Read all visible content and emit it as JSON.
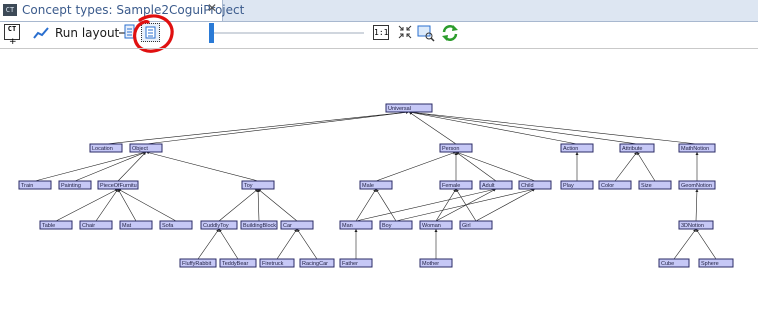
{
  "tab": {
    "icon_label": "CT",
    "title": "Concept types: Sample2CoguiProject",
    "close_glyph": "✕"
  },
  "toolbar": {
    "ct_label": "CT",
    "ct_plus": "+",
    "run_layout_label": "Run layout",
    "one_to_one_label": "1:1",
    "icons": [
      "new-concept-type-icon",
      "run-layout-icon",
      "zoom-out-icon",
      "fit-to-window-icon",
      "zoom-slider",
      "actual-size-icon",
      "shrink-icon",
      "zoom-rectangle-icon",
      "refresh-icon"
    ]
  },
  "colors": {
    "node_fill": "#c6c8f6",
    "node_border": "#2b2b66",
    "annotation": "#e01010",
    "tab_text": "#3b5b8c"
  },
  "graph": {
    "nodes": [
      {
        "id": "Universal",
        "label": "Universal"
      },
      {
        "id": "Location",
        "label": "Location"
      },
      {
        "id": "Object",
        "label": "Object"
      },
      {
        "id": "Person",
        "label": "Person"
      },
      {
        "id": "Action",
        "label": "Action"
      },
      {
        "id": "Attribute",
        "label": "Attribute"
      },
      {
        "id": "MathNotion",
        "label": "MathNotion"
      },
      {
        "id": "Train",
        "label": "Train"
      },
      {
        "id": "Painting",
        "label": "Painting"
      },
      {
        "id": "PieceOfFurniture",
        "label": "PieceOfFurnitu"
      },
      {
        "id": "Toy",
        "label": "Toy"
      },
      {
        "id": "Male",
        "label": "Male"
      },
      {
        "id": "Female",
        "label": "Female"
      },
      {
        "id": "Adult",
        "label": "Adult"
      },
      {
        "id": "Child",
        "label": "Child"
      },
      {
        "id": "Play",
        "label": "Play"
      },
      {
        "id": "Color",
        "label": "Color"
      },
      {
        "id": "Size",
        "label": "Size"
      },
      {
        "id": "GeomNotion",
        "label": "GeomNotion"
      },
      {
        "id": "Table",
        "label": "Table"
      },
      {
        "id": "Chair",
        "label": "Chair"
      },
      {
        "id": "Mat",
        "label": "Mat"
      },
      {
        "id": "Sofa",
        "label": "Sofa"
      },
      {
        "id": "CuddlyToy",
        "label": "CuddlyToy"
      },
      {
        "id": "BuildingBlock",
        "label": "BuildingBlock"
      },
      {
        "id": "Car",
        "label": "Car"
      },
      {
        "id": "Man",
        "label": "Man"
      },
      {
        "id": "Boy",
        "label": "Boy"
      },
      {
        "id": "Woman",
        "label": "Woman"
      },
      {
        "id": "Girl",
        "label": "Girl"
      },
      {
        "id": "ThreeDNotion",
        "label": "3DNotion"
      },
      {
        "id": "FluffyRabbit",
        "label": "FluffyRabbit"
      },
      {
        "id": "TeddyBear",
        "label": "TeddyBear"
      },
      {
        "id": "Firetruck",
        "label": "Firetruck"
      },
      {
        "id": "RacingCar",
        "label": "RacingCar"
      },
      {
        "id": "Father",
        "label": "Father"
      },
      {
        "id": "Mother",
        "label": "Mother"
      },
      {
        "id": "Cube",
        "label": "Cube"
      },
      {
        "id": "Sphere",
        "label": "Sphere"
      }
    ],
    "edges": [
      [
        "Location",
        "Universal"
      ],
      [
        "Object",
        "Universal"
      ],
      [
        "Person",
        "Universal"
      ],
      [
        "Action",
        "Universal"
      ],
      [
        "Attribute",
        "Universal"
      ],
      [
        "MathNotion",
        "Universal"
      ],
      [
        "Train",
        "Object"
      ],
      [
        "Painting",
        "Object"
      ],
      [
        "PieceOfFurniture",
        "Object"
      ],
      [
        "Toy",
        "Object"
      ],
      [
        "Male",
        "Person"
      ],
      [
        "Female",
        "Person"
      ],
      [
        "Adult",
        "Person"
      ],
      [
        "Child",
        "Person"
      ],
      [
        "Play",
        "Action"
      ],
      [
        "Color",
        "Attribute"
      ],
      [
        "Size",
        "Attribute"
      ],
      [
        "GeomNotion",
        "MathNotion"
      ],
      [
        "Table",
        "PieceOfFurniture"
      ],
      [
        "Chair",
        "PieceOfFurniture"
      ],
      [
        "Mat",
        "PieceOfFurniture"
      ],
      [
        "Sofa",
        "PieceOfFurniture"
      ],
      [
        "CuddlyToy",
        "Toy"
      ],
      [
        "BuildingBlock",
        "Toy"
      ],
      [
        "Car",
        "Toy"
      ],
      [
        "Man",
        "Male"
      ],
      [
        "Man",
        "Adult"
      ],
      [
        "Boy",
        "Male"
      ],
      [
        "Boy",
        "Child"
      ],
      [
        "Woman",
        "Female"
      ],
      [
        "Woman",
        "Adult"
      ],
      [
        "Girl",
        "Female"
      ],
      [
        "Girl",
        "Child"
      ],
      [
        "ThreeDNotion",
        "GeomNotion"
      ],
      [
        "FluffyRabbit",
        "CuddlyToy"
      ],
      [
        "TeddyBear",
        "CuddlyToy"
      ],
      [
        "Firetruck",
        "Car"
      ],
      [
        "RacingCar",
        "Car"
      ],
      [
        "Father",
        "Man"
      ],
      [
        "Mother",
        "Woman"
      ],
      [
        "Cube",
        "ThreeDNotion"
      ],
      [
        "Sphere",
        "ThreeDNotion"
      ]
    ]
  }
}
